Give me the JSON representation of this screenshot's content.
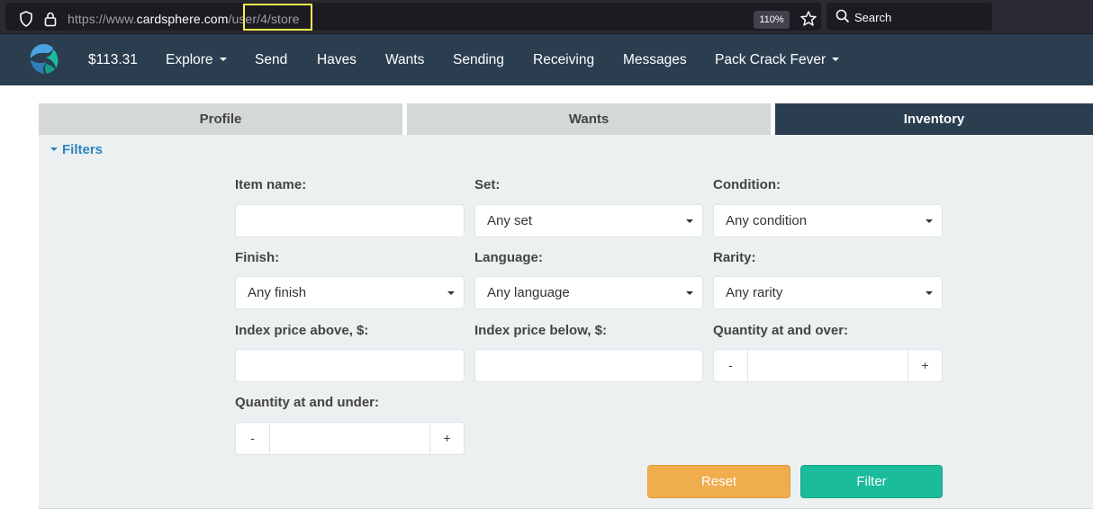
{
  "browser": {
    "url_prefix": "https://www.",
    "url_host": "cardsphere.com",
    "url_path": "/user/4/store",
    "zoom": "110%",
    "search_placeholder": "Search"
  },
  "nav": {
    "balance": "$113.31",
    "items": [
      {
        "label": "Explore",
        "dropdown": true
      },
      {
        "label": "Send"
      },
      {
        "label": "Haves"
      },
      {
        "label": "Wants"
      },
      {
        "label": "Sending"
      },
      {
        "label": "Receiving"
      },
      {
        "label": "Messages"
      },
      {
        "label": "Pack Crack Fever",
        "dropdown": true
      }
    ]
  },
  "tabs": [
    {
      "label": "Profile",
      "active": false
    },
    {
      "label": "Wants",
      "active": false
    },
    {
      "label": "Inventory",
      "active": true
    }
  ],
  "filters": {
    "toggle_label": "Filters",
    "item_name": {
      "label": "Item name:",
      "value": ""
    },
    "set": {
      "label": "Set:",
      "value": "Any set"
    },
    "condition": {
      "label": "Condition:",
      "value": "Any condition"
    },
    "finish": {
      "label": "Finish:",
      "value": "Any finish"
    },
    "language": {
      "label": "Language:",
      "value": "Any language"
    },
    "rarity": {
      "label": "Rarity:",
      "value": "Any rarity"
    },
    "price_above": {
      "label": "Index price above, $:",
      "value": ""
    },
    "price_below": {
      "label": "Index price below, $:",
      "value": ""
    },
    "qty_over": {
      "label": "Quantity at and over:",
      "minus": "-",
      "plus": "+",
      "value": ""
    },
    "qty_under": {
      "label": "Quantity at and under:",
      "minus": "-",
      "plus": "+",
      "value": ""
    },
    "reset_label": "Reset",
    "filter_label": "Filter"
  },
  "colors": {
    "nav_bg": "#2b3e50",
    "reset": "#f0ad4e",
    "filter": "#1abc9c",
    "link": "#2c86c2",
    "url_highlight": "#f8f050"
  }
}
